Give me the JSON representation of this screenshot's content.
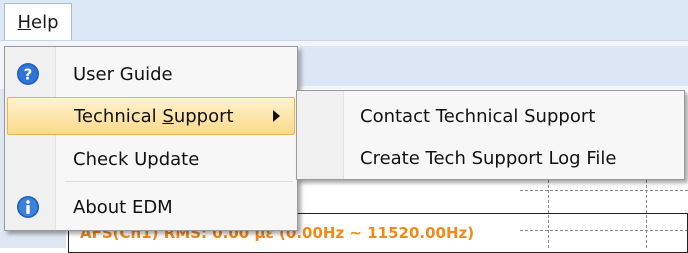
{
  "menubar": {
    "help_label_mnemonic": "H",
    "help_label_rest": "elp"
  },
  "help_menu": {
    "items": [
      {
        "label": "User Guide",
        "icon": "question-icon",
        "icon_color": "#1f5fbf"
      },
      {
        "label_before": "Technical ",
        "label_mnemonic": "S",
        "label_after": "upport",
        "has_submenu": true,
        "highlighted": true
      },
      {
        "label": "Check Update"
      },
      {
        "label": "About EDM",
        "icon": "info-icon",
        "icon_color": "#2a6fd0"
      }
    ]
  },
  "tech_support_submenu": {
    "items": [
      {
        "label": "Contact Technical Support"
      },
      {
        "label": "Create Tech Support Log File"
      }
    ]
  },
  "plot": {
    "label": "AFS(Ch1) RMS: 0.00 με (0.00Hz ~ 11520.00Hz)",
    "label_color": "#f08a1c"
  },
  "colors": {
    "highlight_top": "#fff3cf",
    "highlight_bottom": "#fbd98a",
    "highlight_border": "#e5b650",
    "menubar_bg": "#dde8f6"
  }
}
